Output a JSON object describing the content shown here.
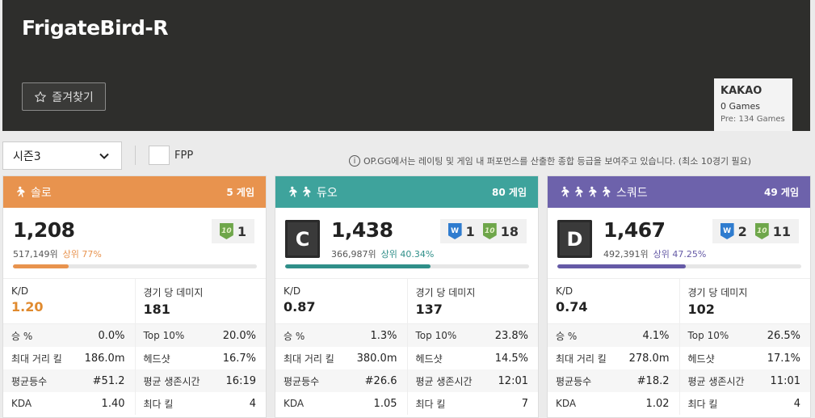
{
  "header": {
    "name": "FrigateBird-R",
    "favorite_label": "즐겨찾기",
    "server": {
      "name": "KAKAO",
      "games": "0 Games",
      "pre": "Pre: 134 Games"
    }
  },
  "filters": {
    "season": "시즌3",
    "fpp_label": "FPP",
    "info_note": "OP.GG에서는 레이팅 및 게임 내 퍼포먼스를 산출한 종합 등급을 보여주고 있습니다. (최소 10경기 필요)"
  },
  "colors": {
    "solo": "#e8934e",
    "duo": "#3ea39c",
    "squad": "#6d62ab",
    "solo_bar": "#e8934e",
    "duo_bar": "#2f8f89",
    "squad_bar": "#655aa6"
  },
  "cards": [
    {
      "mode": "솔로",
      "games": "5 게임",
      "icon": "runner-icon",
      "rating": "1,208",
      "rank": "517,149위",
      "top_pct": "상위 77%",
      "progress": 0.23,
      "grade": "",
      "badges": [
        {
          "type": "ten",
          "icon_text": "10",
          "count": "1"
        }
      ],
      "kd_label": "K/D",
      "kd": "1.20",
      "dmg_label": "경기 당 데미지",
      "dmg": "181",
      "rows": [
        {
          "l1": "승 %",
          "v1": "0.0%",
          "l2": "Top 10%",
          "v2": "20.0%"
        },
        {
          "l1": "최대 거리 킬",
          "v1": "186.0m",
          "l2": "헤드샷",
          "v2": "16.7%"
        },
        {
          "l1": "평균등수",
          "v1": "#51.2",
          "l2": "평균 생존시간",
          "v2": "16:19"
        },
        {
          "l1": "KDA",
          "v1": "1.40",
          "l2": "최다 킬",
          "v2": "4"
        }
      ]
    },
    {
      "mode": "듀오",
      "games": "80 게임",
      "icon": "two-runners-icon",
      "rating": "1,438",
      "rank": "366,987위",
      "top_pct": "상위 40.34%",
      "progress": 0.5966,
      "grade": "C",
      "badges": [
        {
          "type": "w",
          "icon_text": "W",
          "count": "1"
        },
        {
          "type": "ten",
          "icon_text": "10",
          "count": "18"
        }
      ],
      "kd_label": "K/D",
      "kd": "0.87",
      "dmg_label": "경기 당 데미지",
      "dmg": "137",
      "rows": [
        {
          "l1": "승 %",
          "v1": "1.3%",
          "l2": "Top 10%",
          "v2": "23.8%"
        },
        {
          "l1": "최대 거리 킬",
          "v1": "380.0m",
          "l2": "헤드샷",
          "v2": "14.5%"
        },
        {
          "l1": "평균등수",
          "v1": "#26.6",
          "l2": "평균 생존시간",
          "v2": "12:01"
        },
        {
          "l1": "KDA",
          "v1": "1.05",
          "l2": "최다 킬",
          "v2": "7"
        }
      ]
    },
    {
      "mode": "스쿼드",
      "games": "49 게임",
      "icon": "four-runners-icon",
      "rating": "1,467",
      "rank": "492,391위",
      "top_pct": "상위 47.25%",
      "progress": 0.5275,
      "grade": "D",
      "badges": [
        {
          "type": "w",
          "icon_text": "W",
          "count": "2"
        },
        {
          "type": "ten",
          "icon_text": "10",
          "count": "11"
        }
      ],
      "kd_label": "K/D",
      "kd": "0.74",
      "dmg_label": "경기 당 데미지",
      "dmg": "102",
      "rows": [
        {
          "l1": "승 %",
          "v1": "4.1%",
          "l2": "Top 10%",
          "v2": "26.5%"
        },
        {
          "l1": "최대 거리 킬",
          "v1": "278.0m",
          "l2": "헤드샷",
          "v2": "17.1%"
        },
        {
          "l1": "평균등수",
          "v1": "#18.2",
          "l2": "평균 생존시간",
          "v2": "11:01"
        },
        {
          "l1": "KDA",
          "v1": "1.02",
          "l2": "최다 킬",
          "v2": "4"
        }
      ]
    }
  ]
}
